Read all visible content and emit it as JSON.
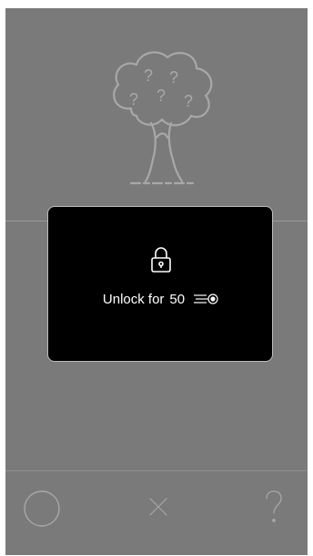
{
  "tree": {
    "icon": "mystery-tree-icon",
    "question_marks": [
      "?",
      "?",
      "?",
      "?",
      "?"
    ]
  },
  "unlock_dialog": {
    "lock_icon": "padlock-icon",
    "label": "Unlock for",
    "cost": "50",
    "currency_icon": "coin-icon"
  },
  "bottom_bar": {
    "left_icon": "circle-icon",
    "center_icon": "close-icon",
    "right_icon": "question-icon"
  },
  "colors": {
    "background": "#7a7a7a",
    "modal": "#000000",
    "line_art": "#a8a8a8",
    "text": "#ffffff"
  }
}
